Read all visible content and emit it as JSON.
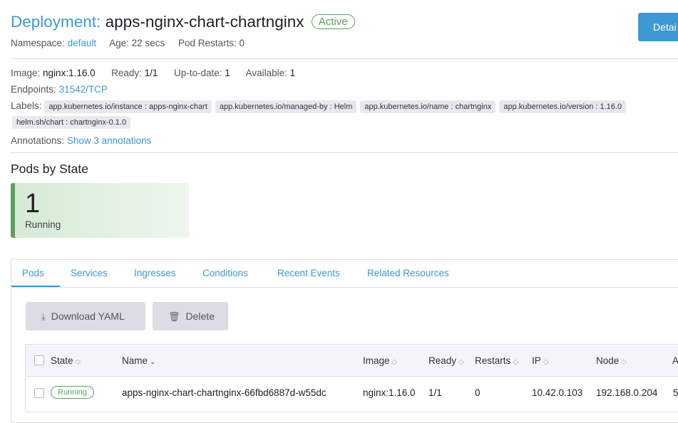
{
  "header": {
    "kind": "Deployment:",
    "name": "apps-nginx-chart-chartnginx",
    "state": "Active",
    "detail_button": "Detai"
  },
  "meta": {
    "namespace_label": "Namespace:",
    "namespace_value": "default",
    "age_label": "Age:",
    "age_value": "22 secs",
    "restarts_label": "Pod Restarts:",
    "restarts_value": "0"
  },
  "info": {
    "image_label": "Image:",
    "image_value": "nginx:1.16.0",
    "ready_label": "Ready:",
    "ready_value": "1/1",
    "uptodate_label": "Up-to-date:",
    "uptodate_value": "1",
    "available_label": "Available:",
    "available_value": "1",
    "endpoints_label": "Endpoints:",
    "endpoints_value": "31542/TCP",
    "labels_label": "Labels:",
    "labels": [
      "app.kubernetes.io/instance : apps-nginx-chart",
      "app.kubernetes.io/managed-by : Helm",
      "app.kubernetes.io/name : chartnginx",
      "app.kubernetes.io/version : 1.16.0",
      "helm.sh/chart : chartnginx-0.1.0"
    ],
    "annotations_label": "Annotations:",
    "annotations_link": "Show 3 annotations"
  },
  "pods_by_state": {
    "heading": "Pods by State",
    "count": "1",
    "state": "Running"
  },
  "tabs": [
    "Pods",
    "Services",
    "Ingresses",
    "Conditions",
    "Recent Events",
    "Related Resources"
  ],
  "actions": {
    "download": "Download YAML",
    "delete": "Delete"
  },
  "table": {
    "columns": [
      "State",
      "Name",
      "Image",
      "Ready",
      "Restarts",
      "IP",
      "Node",
      "A"
    ],
    "rows": [
      {
        "state": "Running",
        "name": "apps-nginx-chart-chartnginx-66fbd6887d-w55dc",
        "image": "nginx:1.16.0",
        "ready": "1/1",
        "restarts": "0",
        "ip": "10.42.0.103",
        "node": "192.168.0.204",
        "extra": "5"
      }
    ]
  },
  "colors": {
    "accent": "#3d98d3",
    "active": "#5aa05a",
    "chip_bg": "#e8e9ee"
  }
}
